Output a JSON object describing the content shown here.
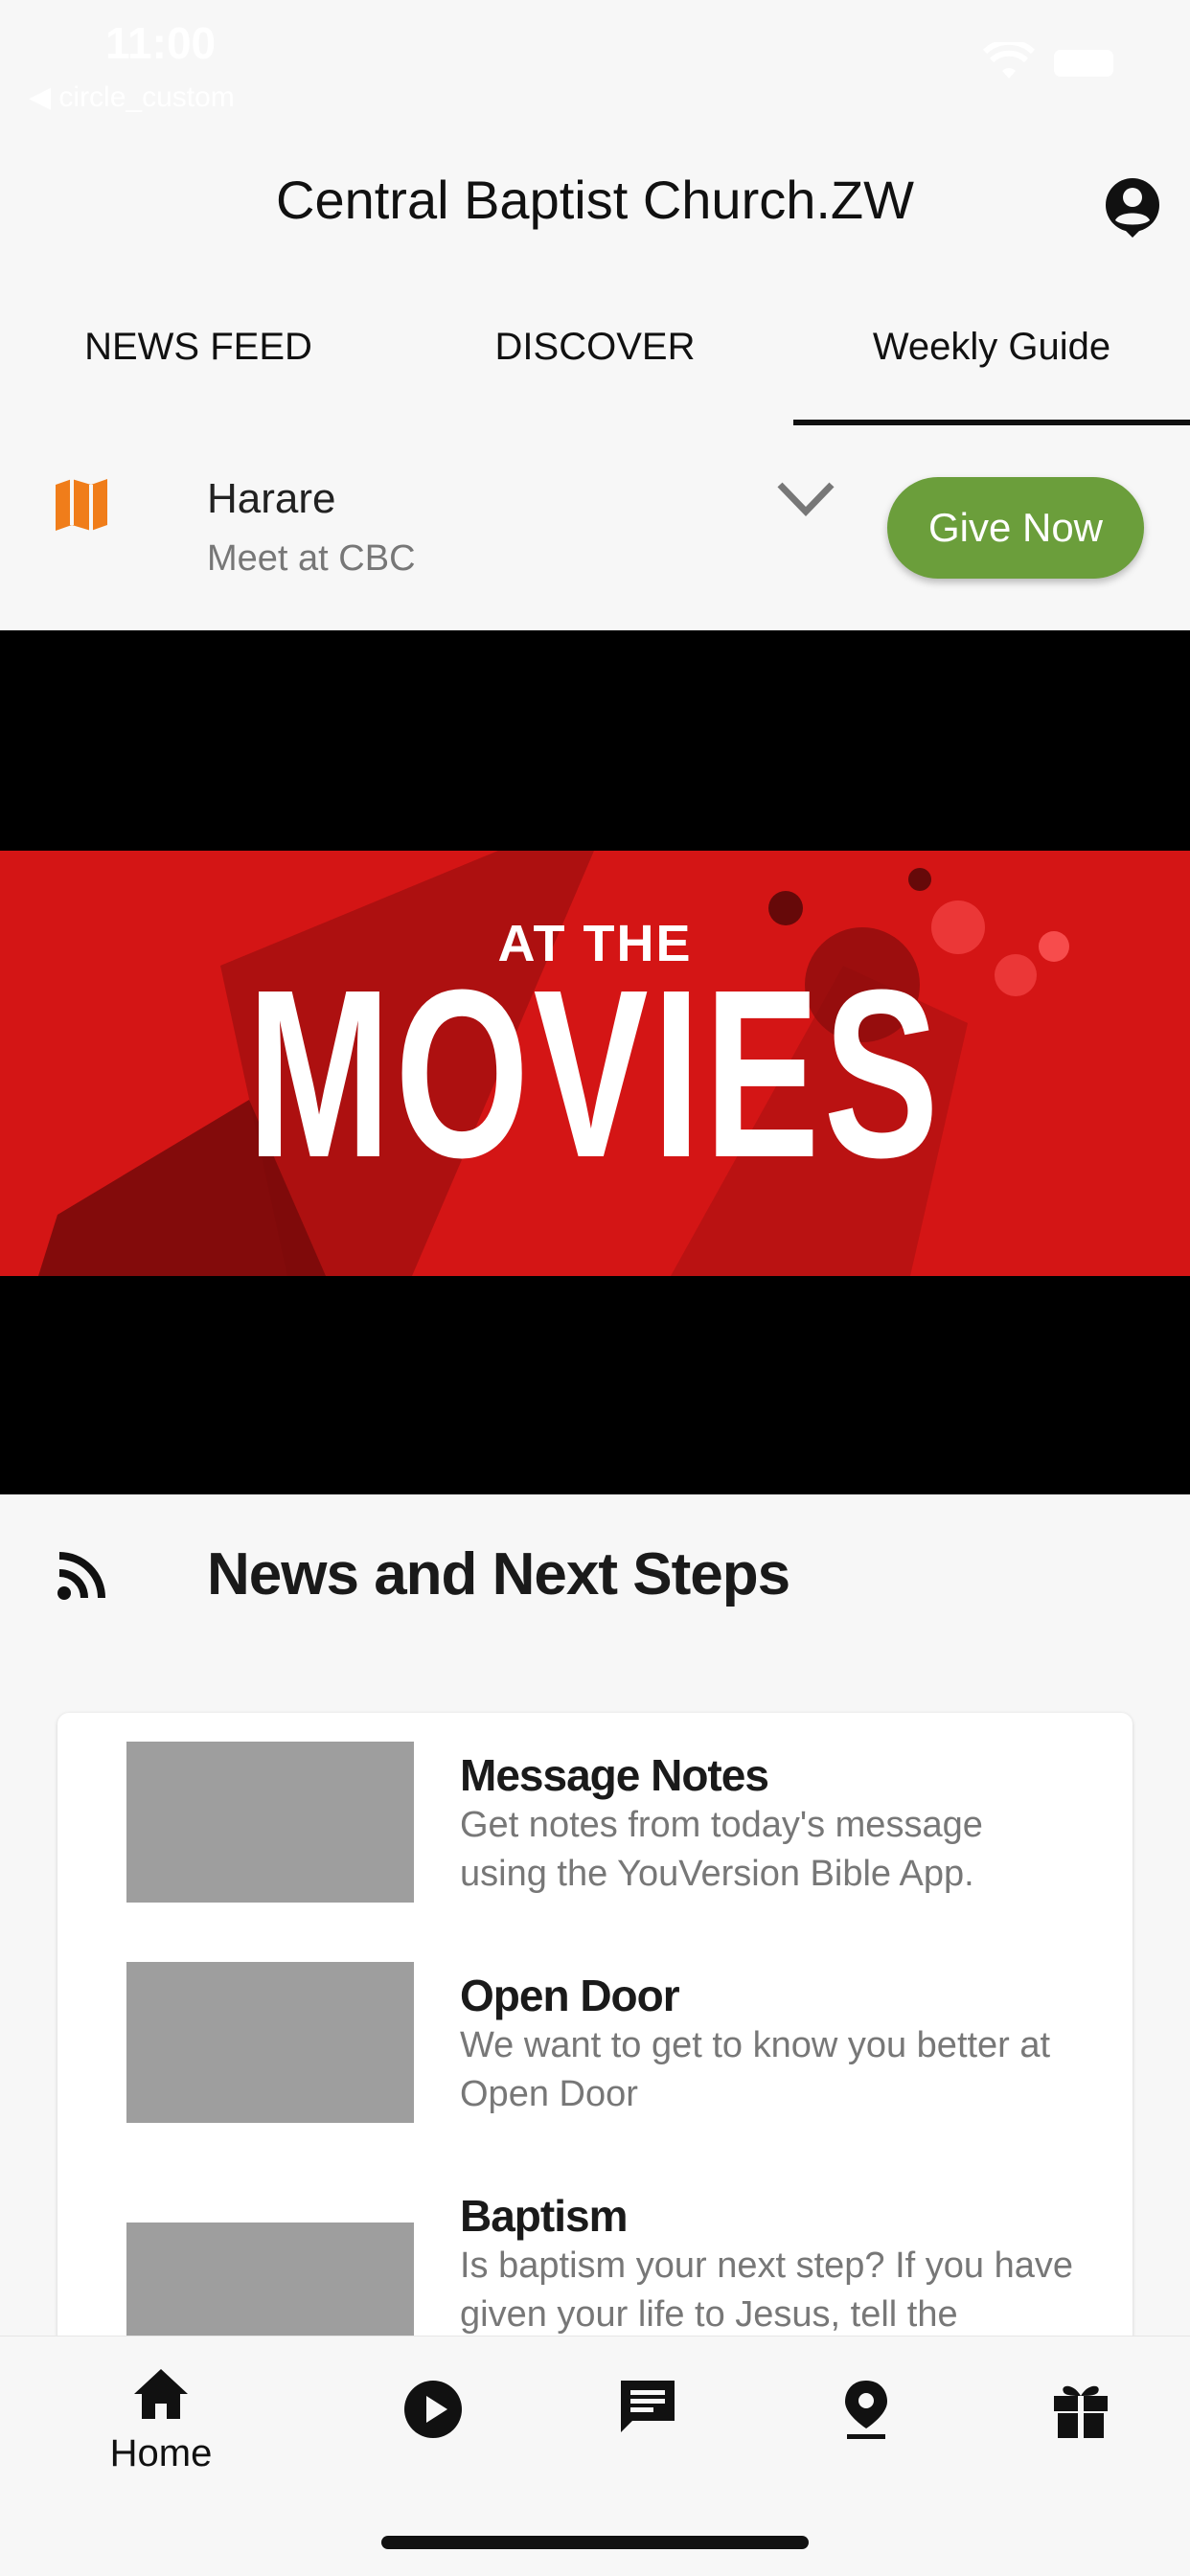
{
  "status_bar": {
    "time": "11:00",
    "back_label": "◀ circle_custom"
  },
  "header": {
    "title": "Central Baptist Church.ZW"
  },
  "tabs": [
    {
      "label": "NEWS FEED"
    },
    {
      "label": "DISCOVER"
    },
    {
      "label": "Weekly Guide"
    }
  ],
  "location": {
    "name": "Harare",
    "subtitle": "Meet at CBC",
    "give_label": "Give Now"
  },
  "hero": {
    "small_text": "AT THE",
    "big_text": "MOVIES"
  },
  "section": {
    "title": "News and Next Steps"
  },
  "items": [
    {
      "title": "Message Notes",
      "desc": "Get notes from today's message using the YouVersion Bible App."
    },
    {
      "title": "Open Door",
      "desc": "We want to get to know you better at Open Door"
    },
    {
      "title": "Baptism",
      "desc": "Is baptism your next step? If you have given your life to Jesus, tell the"
    }
  ],
  "bottom_nav": [
    {
      "icon": "home-icon",
      "label": "Home"
    },
    {
      "icon": "play-icon",
      "label": ""
    },
    {
      "icon": "chat-icon",
      "label": ""
    },
    {
      "icon": "location-pin-icon",
      "label": ""
    },
    {
      "icon": "gift-icon",
      "label": ""
    }
  ],
  "colors": {
    "accent_green": "#6b9e3b",
    "map_orange": "#f07d1a",
    "hero_red": "#d41515"
  }
}
